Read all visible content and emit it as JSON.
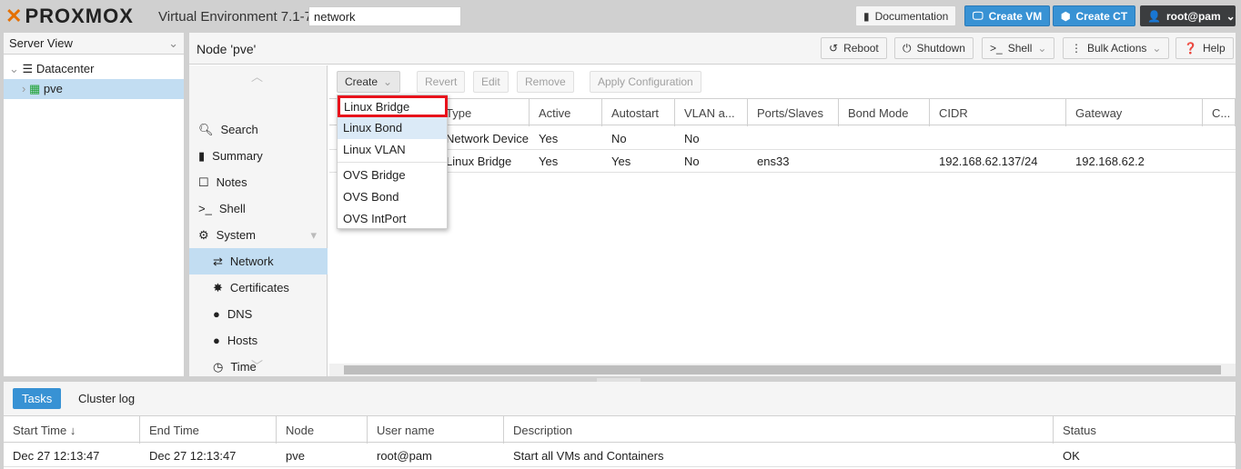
{
  "topbar": {
    "logo_text": "PROXMOX",
    "version": "Virtual Environment 7.1-7",
    "search_value": "network",
    "documentation": "Documentation",
    "create_vm": "Create VM",
    "create_ct": "Create CT",
    "user": "root@pam"
  },
  "tree": {
    "view": "Server View",
    "items": [
      {
        "label": "Datacenter"
      },
      {
        "label": "pve"
      }
    ]
  },
  "node": {
    "title": "Node 'pve'",
    "reboot": "Reboot",
    "shutdown": "Shutdown",
    "shell": "Shell",
    "bulk": "Bulk Actions",
    "help": "Help"
  },
  "nav": [
    {
      "label": "Search"
    },
    {
      "label": "Summary"
    },
    {
      "label": "Notes"
    },
    {
      "label": "Shell"
    },
    {
      "label": "System"
    },
    {
      "label": "Network"
    },
    {
      "label": "Certificates"
    },
    {
      "label": "DNS"
    },
    {
      "label": "Hosts"
    },
    {
      "label": "Time"
    }
  ],
  "toolbar": {
    "create": "Create",
    "revert": "Revert",
    "edit": "Edit",
    "remove": "Remove",
    "apply": "Apply Configuration"
  },
  "create_menu": [
    {
      "label": "Linux Bridge"
    },
    {
      "label": "Linux Bond"
    },
    {
      "label": "Linux VLAN"
    },
    {
      "label": "OVS Bridge"
    },
    {
      "label": "OVS Bond"
    },
    {
      "label": "OVS IntPort"
    }
  ],
  "grid": {
    "columns": [
      "",
      "Type",
      "Active",
      "Autostart",
      "VLAN a...",
      "Ports/Slaves",
      "Bond Mode",
      "CIDR",
      "Gateway",
      "C..."
    ],
    "rows": [
      [
        "",
        "Network Device",
        "Yes",
        "No",
        "No",
        "",
        "",
        "",
        "",
        " "
      ],
      [
        "",
        "Linux Bridge",
        "Yes",
        "Yes",
        "No",
        "ens33",
        "",
        "192.168.62.137/24",
        "192.168.62.2",
        ""
      ]
    ]
  },
  "bottom": {
    "tabs": [
      "Tasks",
      "Cluster log"
    ],
    "columns": [
      "Start Time ↓",
      "End Time",
      "Node",
      "User name",
      "Description",
      "Status"
    ],
    "rows": [
      [
        "Dec 27 12:13:47",
        "Dec 27 12:13:47",
        "pve",
        "root@pam",
        "Start all VMs and Containers",
        "OK"
      ]
    ]
  },
  "colors": {
    "accent": "#3892d4",
    "highlight": "#c2ddf2",
    "logo": "#e57000",
    "menu_outline": "#e8121b"
  }
}
